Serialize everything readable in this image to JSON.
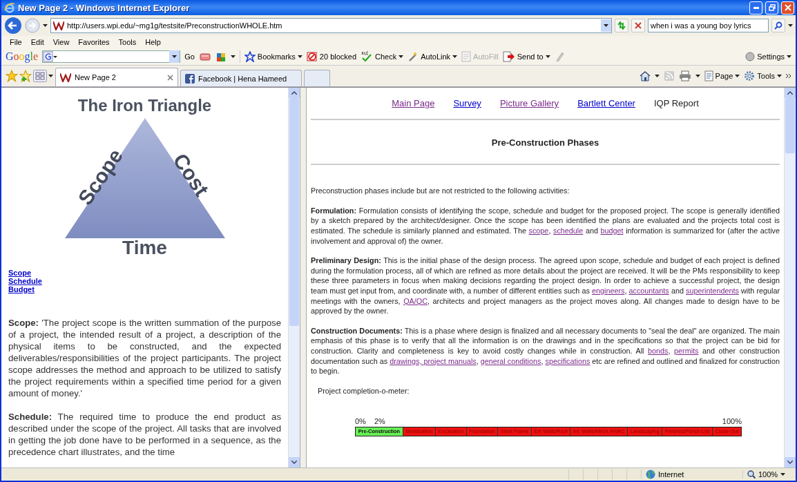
{
  "window": {
    "title": "New Page 2 - Windows Internet Explorer"
  },
  "address_bar": {
    "url": "http://users.wpi.edu/~mg1g/testsite/PreconstructionWHOLE.htm",
    "search_value": "when i was a young boy lyrics"
  },
  "menu": [
    "File",
    "Edit",
    "View",
    "Favorites",
    "Tools",
    "Help"
  ],
  "google_toolbar": {
    "logo": "Google",
    "go": "Go",
    "settings": "Settings",
    "items": [
      {
        "label": "Bookmarks",
        "dropdown": true,
        "disabled": false
      },
      {
        "label": "20 blocked",
        "dropdown": false,
        "disabled": false
      },
      {
        "label": "Check",
        "dropdown": true,
        "disabled": false
      },
      {
        "label": "AutoLink",
        "dropdown": true,
        "disabled": false
      },
      {
        "label": "AutoFill",
        "dropdown": false,
        "disabled": true
      },
      {
        "label": "Send to",
        "dropdown": true,
        "disabled": false
      }
    ]
  },
  "tabs": [
    {
      "label": "New Page 2",
      "selected": true
    },
    {
      "label": "Facebook | Hena Hameed",
      "selected": false
    }
  ],
  "command_bar": [
    "Page",
    "Tools"
  ],
  "left_frame": {
    "image_title": "The Iron Triangle",
    "triangle_labels": [
      "Scope",
      "Cost",
      "Time"
    ],
    "links": [
      "Scope",
      "Schedule",
      "Budget"
    ],
    "paragraphs": [
      {
        "term": "Scope:",
        "text": " 'The project scope is the written summation of the purpose of a project, the intended result of a project, a description of the physical items to be constructed, and the expected deliverables/responsibilities of the project participants. The project scope addresses the method and approach to be utilized to satisfy the project requirements within a specified time period for a given amount of money.'"
      },
      {
        "term": "Schedule:",
        "text": " The required time to produce the end product as described under the scope of the project. All tasks that are involved in getting the job done have to be performed in a sequence, as the precedence chart illustrates, and the time"
      }
    ]
  },
  "right_frame": {
    "nav": [
      {
        "label": "Main Page",
        "kind": "visited"
      },
      {
        "label": "Survey",
        "kind": "link"
      },
      {
        "label": "Picture Gallery",
        "kind": "visited"
      },
      {
        "label": "Bartlett Center",
        "kind": "link"
      },
      {
        "label": "IQP Report",
        "kind": "current"
      }
    ],
    "heading": "Pre-Construction Phases",
    "intro": "Preconstruction phases include but are not restricted to the following activities:",
    "sections": [
      {
        "term": "Formulation:",
        "parts": [
          {
            "kind": "text",
            "text": " Formulation consists of identifying the scope, schedule and budget for the proposed project. The scope is generally identified by a sketch prepared by the architect/designer. Once the scope has been identified the plans are evaluated and the projects total cost is estimated. The schedule is similarly planned and estimated. The "
          },
          {
            "kind": "link",
            "text": "scope"
          },
          {
            "kind": "text",
            "text": ", "
          },
          {
            "kind": "link",
            "text": "schedule"
          },
          {
            "kind": "text",
            "text": " and "
          },
          {
            "kind": "link",
            "text": "budget"
          },
          {
            "kind": "text",
            "text": " information is summarized for (after the active involvement and approval of) the owner."
          }
        ]
      },
      {
        "term": "Preliminary Design:",
        "parts": [
          {
            "kind": "text",
            "text": " This is the initial phase of the design process. The agreed upon scope, schedule and budget of each project is defined during the formulation process, all of which are refined as more details about the project are received. It will be the PMs responsibility to keep these three parameters in focus when making decisions regarding the project design. In order to achieve a successful project, the design team must get input from, and coordinate with, a number of different entities such as "
          },
          {
            "kind": "link",
            "text": "engineers"
          },
          {
            "kind": "text",
            "text": ", "
          },
          {
            "kind": "link",
            "text": "accountants"
          },
          {
            "kind": "text",
            "text": " and "
          },
          {
            "kind": "link",
            "text": "superintendents"
          },
          {
            "kind": "text",
            "text": " with regular meetings with the owners, "
          },
          {
            "kind": "link",
            "text": "QA/QC"
          },
          {
            "kind": "text",
            "text": ", architects and project managers as the project moves along. All changes made to design have to be approved by the owner."
          }
        ]
      },
      {
        "term": "Construction Documents:",
        "parts": [
          {
            "kind": "text",
            "text": " This is a phase where design is finalized and all necessary documents to \"seal the deal\" are organized. The main emphasis of this phase is to verify that all the information is on the drawings and in the specifications so that the project can be bid for construction. Clarity and completeness is key to avoid costly changes while in construction. All "
          },
          {
            "kind": "link",
            "text": "bonds"
          },
          {
            "kind": "text",
            "text": ", "
          },
          {
            "kind": "link",
            "text": "permits"
          },
          {
            "kind": "text",
            "text": " and other construction documentation such as "
          },
          {
            "kind": "link",
            "text": "drawings, "
          },
          {
            "kind": "link",
            "text": "project manuals"
          },
          {
            "kind": "text",
            "text": ", "
          },
          {
            "kind": "link",
            "text": "general conditions"
          },
          {
            "kind": "text",
            "text": ", "
          },
          {
            "kind": "link",
            "text": "specifications"
          },
          {
            "kind": "text",
            "text": " etc are refined and outlined and finalized for construction to begin."
          }
        ]
      }
    ],
    "meter": {
      "label": "Project completion-o-meter:",
      "ticks": [
        "0%",
        "2%",
        "100%"
      ],
      "segments": [
        {
          "label": "Pre-Construction",
          "color": "#66ee55"
        },
        {
          "label": "Mobilization",
          "color": "#ee1111"
        },
        {
          "label": "Excavation",
          "color": "#ee1111"
        },
        {
          "label": "Foundation",
          "color": "#ee1111"
        },
        {
          "label": "Steel Frame",
          "color": "#ee1111"
        },
        {
          "label": "Ext Walls/Roof",
          "color": "#ee1111"
        },
        {
          "label": "Int. Walls/Mech./HVAC",
          "color": "#ee1111"
        },
        {
          "label": "Landscaping",
          "color": "#ee1111"
        },
        {
          "label": "Finishes/Punch-List",
          "color": "#ee1111"
        },
        {
          "label": "Close-Out",
          "color": "#ee1111"
        }
      ]
    }
  },
  "status_bar": {
    "zone": "Internet",
    "zoom": "100%"
  }
}
